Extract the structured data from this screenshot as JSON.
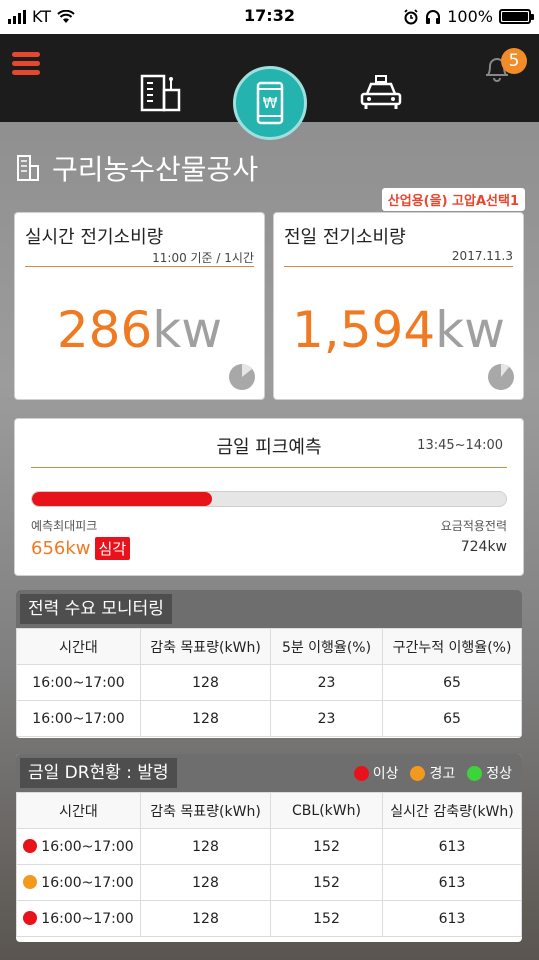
{
  "status_bar": {
    "carrier": "KT",
    "time": "17:32",
    "battery": "100%"
  },
  "nav": {
    "notification_count": "5"
  },
  "page_title": "구리농수산물공사",
  "plan_label": "산업용(을) 고압A선택1",
  "realtime": {
    "title": "실시간 전기소비량",
    "subtitle": "11:00 기준 / 1시간",
    "value": "286",
    "unit": "kw"
  },
  "prevday": {
    "title": "전일 전기소비량",
    "subtitle": "2017.11.3",
    "value": "1,594",
    "unit": "kw"
  },
  "peak": {
    "title": "금일 피크예측",
    "time_range": "13:45~14:00",
    "progress_fraction": 0.38,
    "left_label": "예측최대피크",
    "predicted_value": "656kw",
    "severity": "심각",
    "right_label": "요금적용전력",
    "limit_value": "724kw"
  },
  "monitoring": {
    "title": "전력 수요 모니터링",
    "headers": [
      "시간대",
      "감축 목표량(kWh)",
      "5분 이행율(%)",
      "구간누적 이행율(%)"
    ],
    "rows": [
      [
        "16:00~17:00",
        "128",
        "23",
        "65"
      ],
      [
        "16:00~17:00",
        "128",
        "23",
        "65"
      ]
    ]
  },
  "dr": {
    "title": "금일 DR현황 : 발령",
    "legend": [
      {
        "label": "이상",
        "color": "#e8121a"
      },
      {
        "label": "경고",
        "color": "#f39a1e"
      },
      {
        "label": "정상",
        "color": "#3bd43b"
      }
    ],
    "headers": [
      "시간대",
      "감축 목표량(kWh)",
      "CBL(kWh)",
      "실시간 감축량(kWh)"
    ],
    "rows": [
      {
        "status_color": "#e8121a",
        "cells": [
          "16:00~17:00",
          "128",
          "152",
          "613"
        ]
      },
      {
        "status_color": "#f39a1e",
        "cells": [
          "16:00~17:00",
          "128",
          "152",
          "613"
        ]
      },
      {
        "status_color": "#e8121a",
        "cells": [
          "16:00~17:00",
          "128",
          "152",
          "613"
        ]
      }
    ]
  },
  "colors": {
    "accent_orange": "#f07a22",
    "alert_red": "#e8121a",
    "teal": "#25b3b0"
  }
}
